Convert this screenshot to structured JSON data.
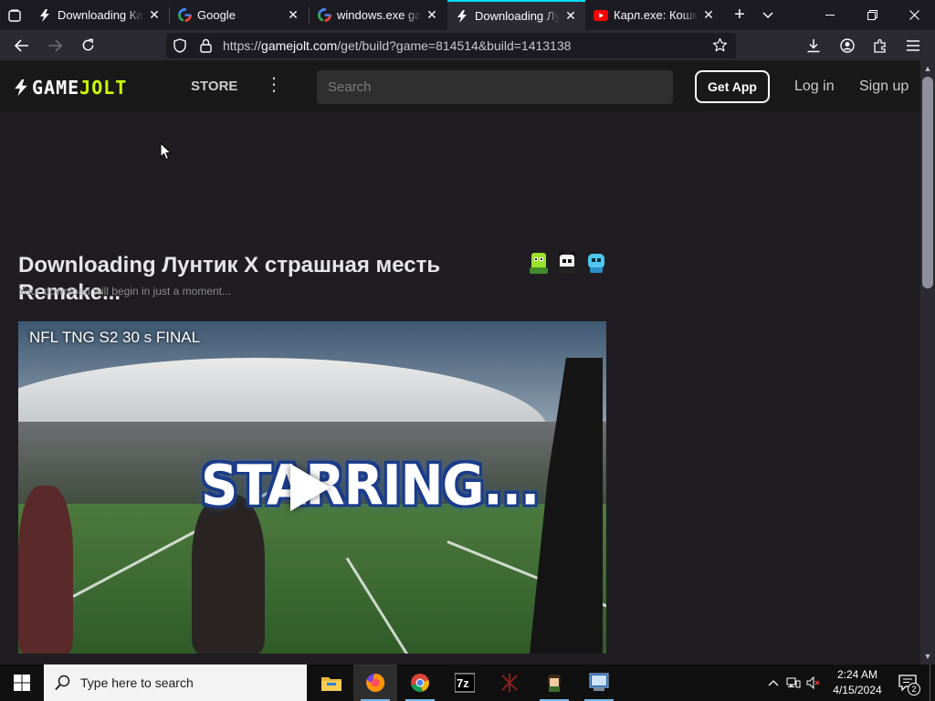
{
  "browser": {
    "tabs": [
      {
        "title": "Downloading Карл.exe",
        "favicon": "gamejolt-bolt-icon",
        "active": false
      },
      {
        "title": "Google",
        "favicon": "google-g-icon",
        "active": false
      },
      {
        "title": "windows.exe gameplay",
        "favicon": "google-g-icon",
        "active": false
      },
      {
        "title": "Downloading Лунтик",
        "favicon": "gamejolt-bolt-icon",
        "active": true
      },
      {
        "title": "Карл.exe: Кошмар",
        "favicon": "youtube-icon",
        "active": false
      }
    ],
    "url_prefix": "https://",
    "url_host": "gamejolt.com",
    "url_path": "/get/build?game=814514&build=1413138"
  },
  "gamejolt": {
    "logo_game": "GAME",
    "logo_jolt": "JOLT",
    "store_label": "STORE",
    "search_placeholder": "Search",
    "get_app_label": "Get App",
    "login_label": "Log in",
    "signup_label": "Sign up"
  },
  "download": {
    "title": "Downloading Лунтик X страшная месть Remake...",
    "subtitle": "Your download will begin in just a moment..."
  },
  "video": {
    "title": "NFL TNG S2 30 s FINAL",
    "overlay_text": "STARRING..."
  },
  "taskbar": {
    "search_placeholder": "Type here to search",
    "time": "2:24 AM",
    "date": "4/15/2024",
    "notification_count": "2"
  },
  "colors": {
    "accent_tab": "#00ddff",
    "gamejolt_green": "#ccff00",
    "page_bg": "#1f1d22"
  }
}
